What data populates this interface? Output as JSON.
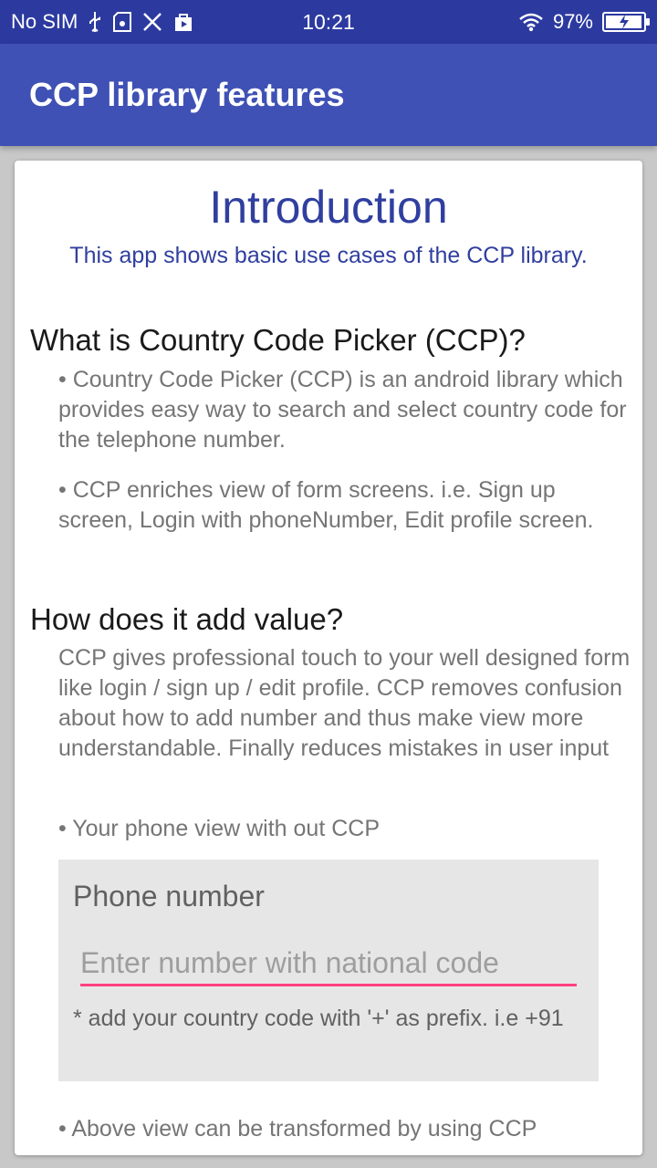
{
  "status_bar": {
    "carrier": "No SIM",
    "time": "10:21",
    "battery_percent": "97%",
    "battery_level": 0.97,
    "icons": [
      "usb-icon",
      "sd-card-icon",
      "tools-icon",
      "play-store-icon",
      "wifi-icon",
      "battery-charging-icon"
    ]
  },
  "app_bar": {
    "title": "CCP library features"
  },
  "intro": {
    "title": "Introduction",
    "subtitle": "This app shows basic use cases of the CCP library."
  },
  "what_is": {
    "heading": "What is Country Code Picker (CCP)?",
    "paragraphs": [
      "• Country Code Picker (CCP) is an android library which provides easy way to search and select country code for the telephone number.",
      "• CCP enriches view of form screens. i.e. Sign up screen, Login with phoneNumber, Edit profile screen."
    ]
  },
  "value": {
    "heading": "How does it add value?",
    "paragraph": "CCP gives professional touch to your well designed form like login / sign up / edit profile. CCP removes confusion about how to add number and thus make view more understandable. Finally reduces mistakes in user input",
    "without_ccp_label": "• Your phone view with out CCP",
    "phone_form": {
      "label": "Phone number",
      "placeholder": "Enter number with national code",
      "hint": "* add your country code with '+' as prefix. i.e +91"
    },
    "transform_note": "• Above view can be transformed by using CCP"
  },
  "colors": {
    "status_bar": "#2c3aa0",
    "app_bar": "#3f51b5",
    "accent": "#ff4081",
    "intro_text": "#303f9f"
  }
}
